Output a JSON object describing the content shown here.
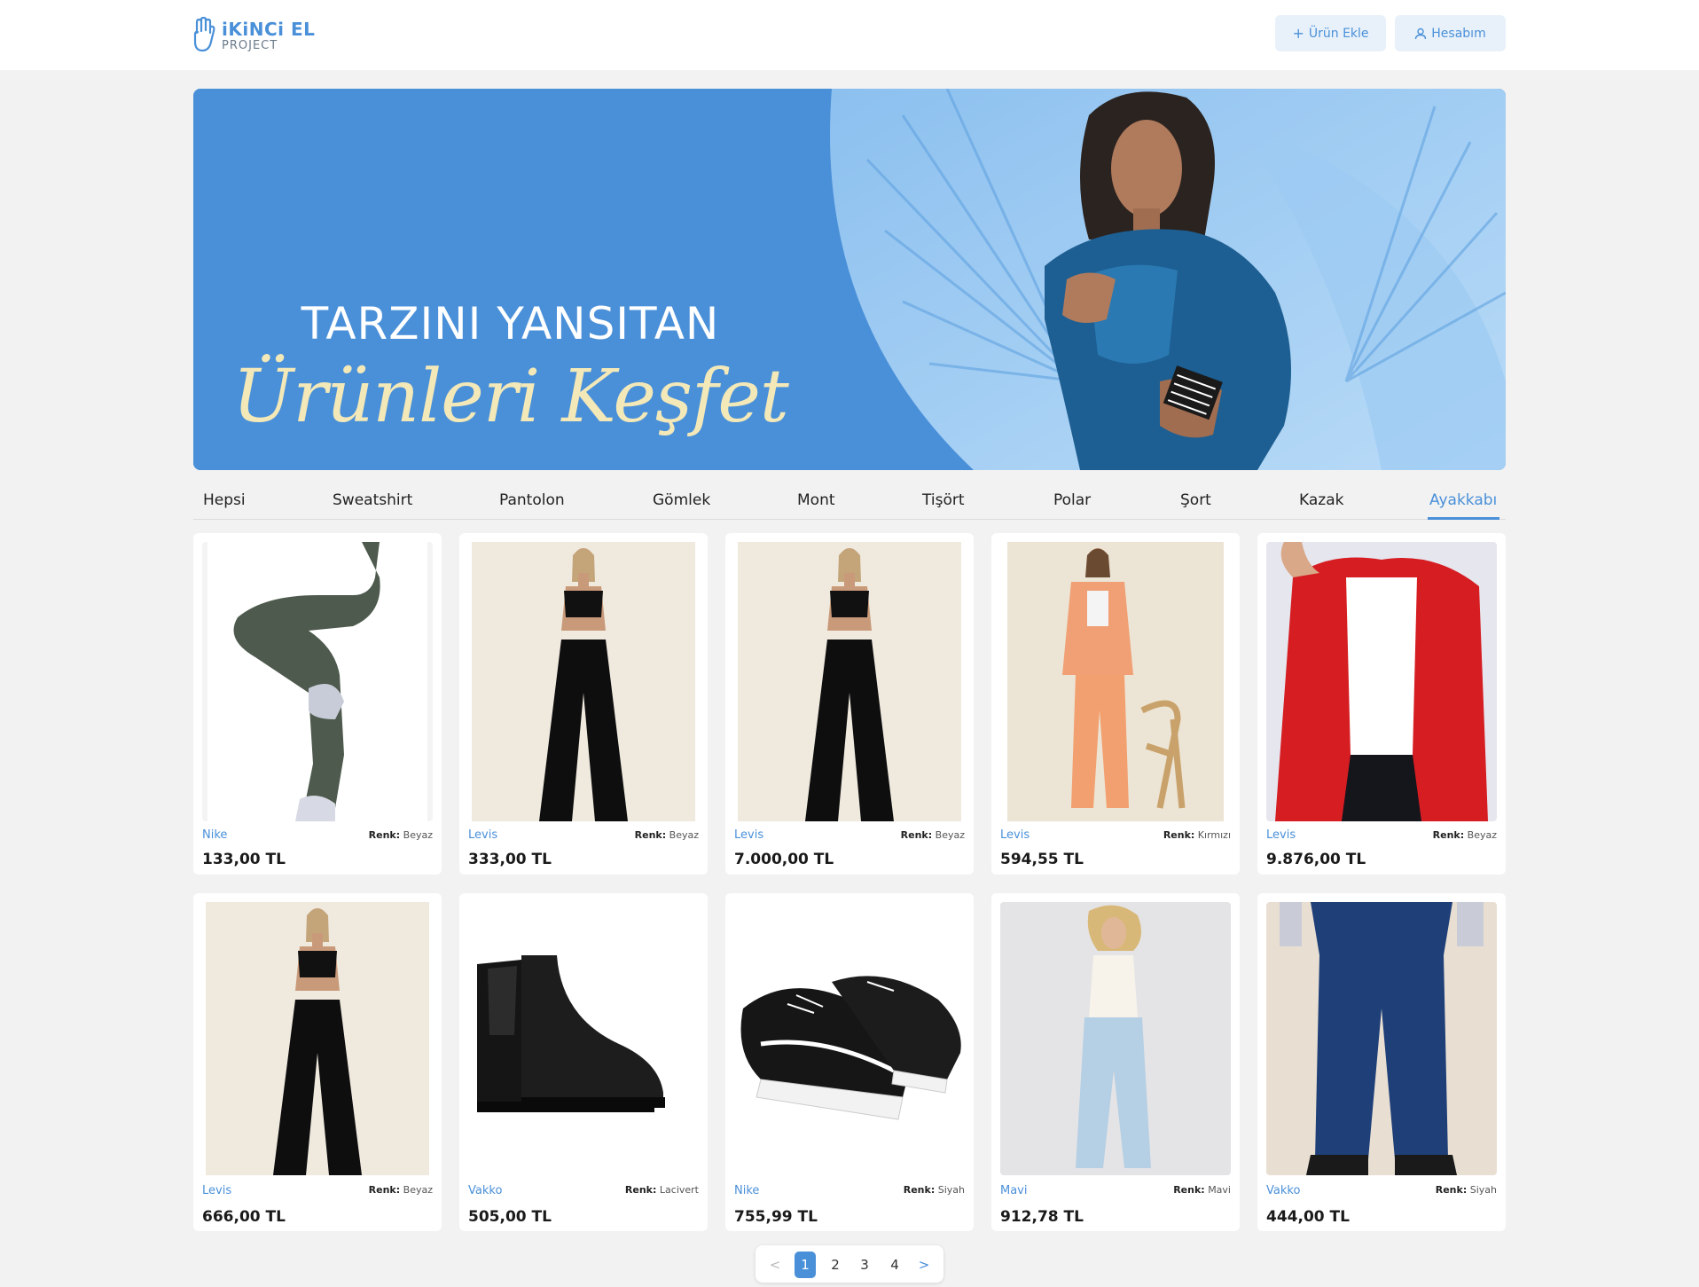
{
  "header": {
    "logo_title": "iKiNCi EL",
    "logo_sub": "PROJECT",
    "add_product": "Ürün Ekle",
    "account": "Hesabım"
  },
  "banner": {
    "line1": "TARZINI YANSITAN",
    "line2": "Ürünleri Keşfet"
  },
  "tabs": [
    "Hepsi",
    "Sweatshirt",
    "Pantolon",
    "Gömlek",
    "Mont",
    "Tişört",
    "Polar",
    "Şort",
    "Kazak",
    "Ayakkabı"
  ],
  "active_tab": "Ayakkabı",
  "color_label": "Renk:",
  "products": [
    {
      "brand": "Nike",
      "color": "Beyaz",
      "price": "133,00 TL"
    },
    {
      "brand": "Levis",
      "color": "Beyaz",
      "price": "333,00 TL"
    },
    {
      "brand": "Levis",
      "color": "Beyaz",
      "price": "7.000,00 TL"
    },
    {
      "brand": "Levis",
      "color": "Kırmızı",
      "price": "594,55 TL"
    },
    {
      "brand": "Levis",
      "color": "Beyaz",
      "price": "9.876,00 TL"
    },
    {
      "brand": "Levis",
      "color": "Beyaz",
      "price": "666,00 TL"
    },
    {
      "brand": "Vakko",
      "color": "Lacivert",
      "price": "505,00 TL"
    },
    {
      "brand": "Nike",
      "color": "Siyah",
      "price": "755,99 TL"
    },
    {
      "brand": "Mavi",
      "color": "Mavi",
      "price": "912,78 TL"
    },
    {
      "brand": "Vakko",
      "color": "Siyah",
      "price": "444,00 TL"
    }
  ],
  "pagination": {
    "prev": "<",
    "pages": [
      "1",
      "2",
      "3",
      "4"
    ],
    "current": "1",
    "next": ">"
  },
  "colors": {
    "accent": "#4a90d9",
    "banner_text": "#f3e8b8",
    "page_bg": "#f2f2f2"
  }
}
